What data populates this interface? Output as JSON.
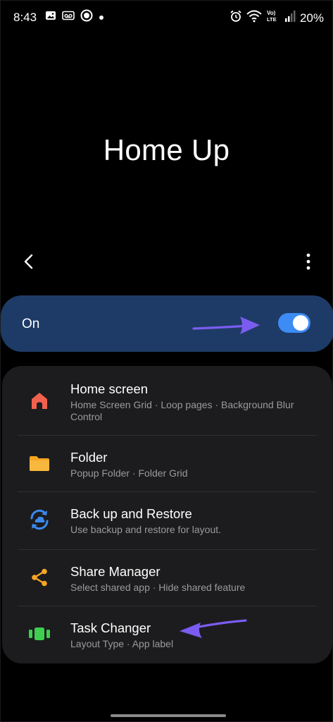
{
  "status_bar": {
    "time": "8:43",
    "battery": "20%",
    "network_label": "Vo) LTE",
    "icons": [
      "image-icon",
      "voicemail-icon",
      "record-icon",
      "dot-icon",
      "alarm-icon",
      "wifi-icon",
      "volte-icon",
      "signal-icon"
    ]
  },
  "page": {
    "title": "Home Up"
  },
  "master_toggle": {
    "label": "On",
    "state": true,
    "accent": "#3d8bf5",
    "background": "#1d3b66"
  },
  "settings": {
    "items": [
      {
        "title": "Home screen",
        "subtitle": "Home Screen Grid · Loop pages · Background Blur Control",
        "icon": "house-icon",
        "color": "#f0614e"
      },
      {
        "title": "Folder",
        "subtitle": "Popup Folder · Folder Grid",
        "icon": "folder-icon",
        "color": "#f5a623"
      },
      {
        "title": "Back up and Restore",
        "subtitle": "Use backup and restore for layout.",
        "icon": "cloud-sync-icon",
        "color": "#3b8af0"
      },
      {
        "title": "Share Manager",
        "subtitle": "Select shared app · Hide shared feature",
        "icon": "share-icon",
        "color": "#f5a623"
      },
      {
        "title": "Task Changer",
        "subtitle": "Layout Type · App label",
        "icon": "task-changer-icon",
        "color": "#3fce4f"
      }
    ]
  },
  "annotation_color": "#7b5cf0"
}
